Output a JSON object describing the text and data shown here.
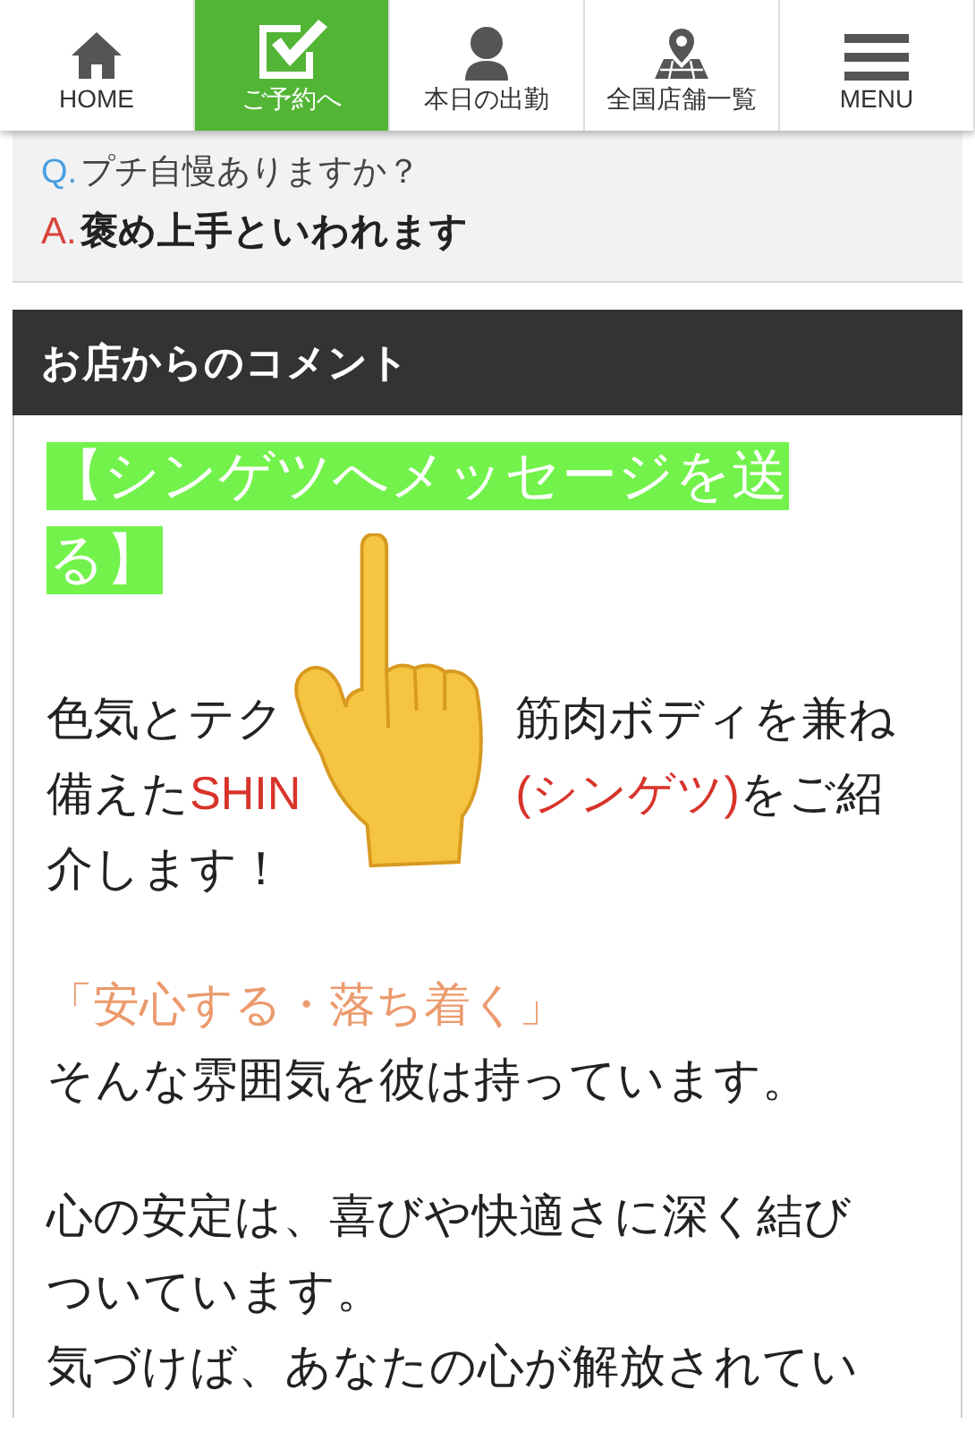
{
  "nav": [
    {
      "label": "HOME",
      "kind": "home",
      "selected": false
    },
    {
      "label": "ご予約へ",
      "kind": "booking",
      "selected": true
    },
    {
      "label": "本日の出勤",
      "kind": "staff",
      "selected": false
    },
    {
      "label": "全国店舗一覧",
      "kind": "stores",
      "selected": false
    },
    {
      "label": "MENU",
      "kind": "menu",
      "selected": false
    }
  ],
  "qa": {
    "q_mark": "Q.",
    "question": "プチ自慢ありますか？",
    "a_mark": "A.",
    "answer": "褒め上手といわれます"
  },
  "comment": {
    "heading": "お店からのコメント",
    "title_lines": [
      "【シンゲツへメッセージを送",
      "る】"
    ],
    "intro_lines": [
      [
        "色気とテク",
        "筋肉ボディを兼ね"
      ],
      [
        "備えた",
        "SHIN",
        "(シンゲツ)",
        "をご紹"
      ],
      [
        "介します！"
      ]
    ],
    "paragraphs": [
      {
        "kind": "accent",
        "text": "「安心する・落ち着く」"
      },
      {
        "kind": "plain",
        "text": "そんな雰囲気を彼は持っています。"
      },
      {
        "kind": "gap"
      },
      {
        "kind": "plain",
        "text": "心の安定は、喜びや快適さに深く結び"
      },
      {
        "kind": "plain",
        "text": "ついています。"
      },
      {
        "kind": "plain",
        "text": "気づけば、あなたの心が解放されてい"
      }
    ]
  }
}
